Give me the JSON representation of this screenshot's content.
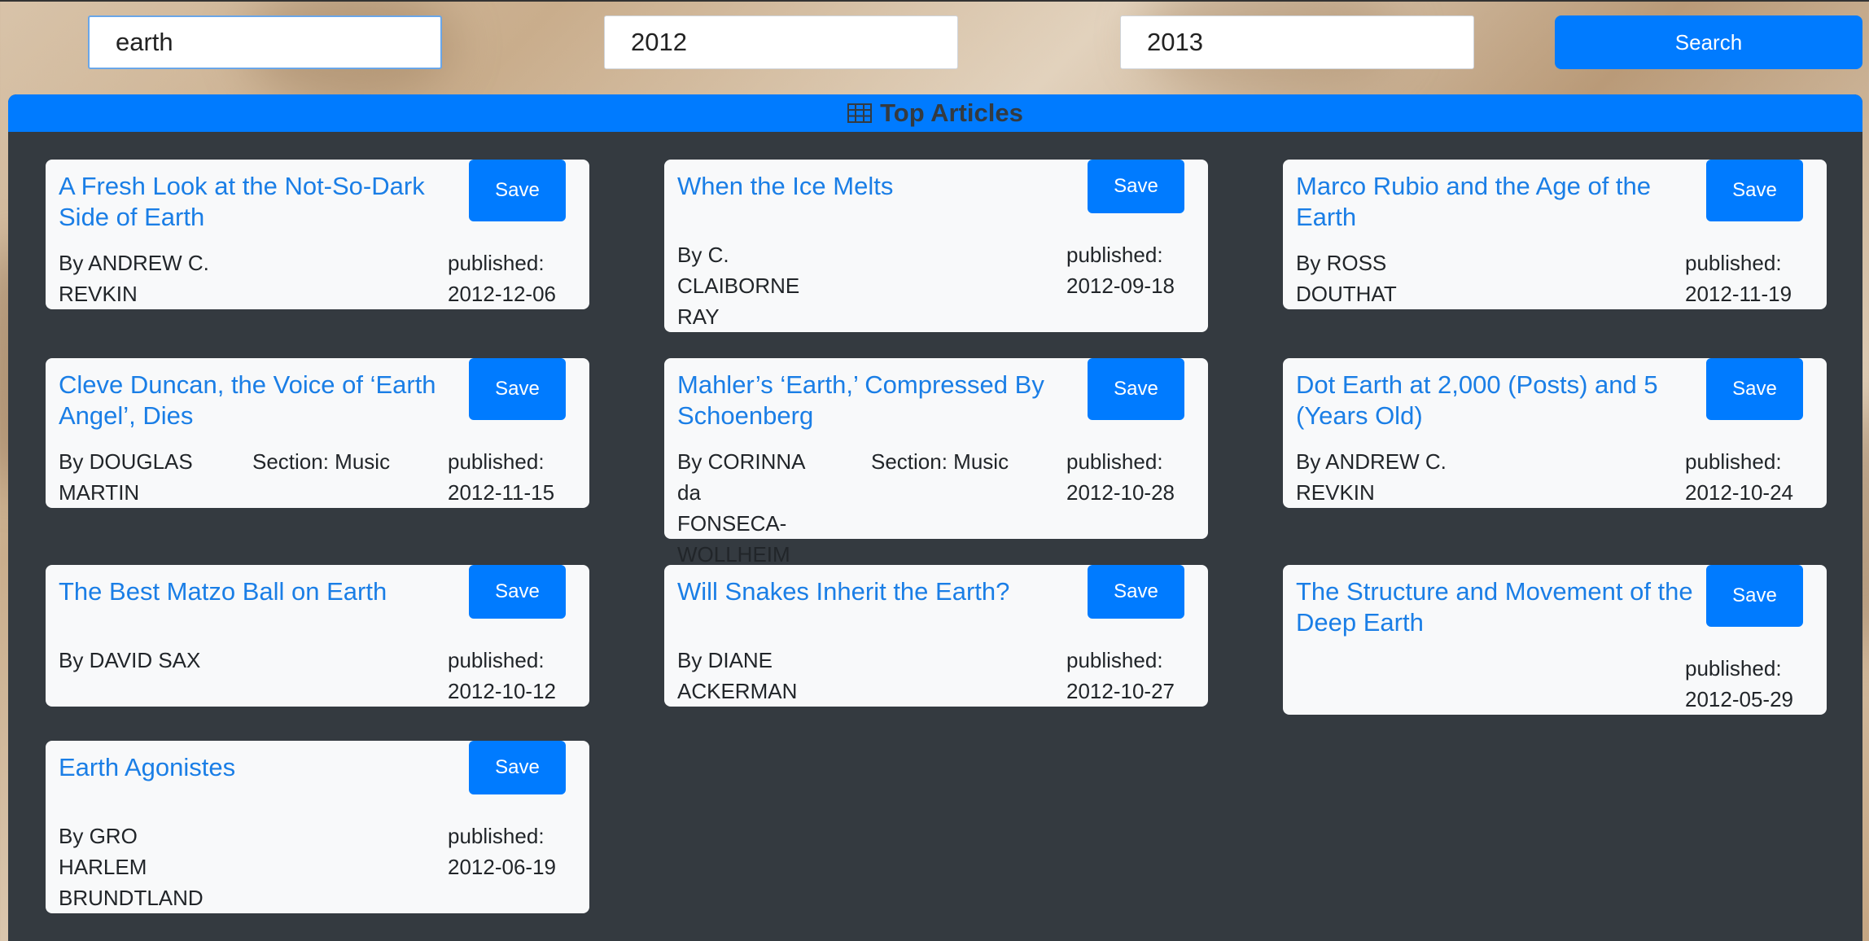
{
  "search": {
    "query": "earth",
    "start_year": "2012",
    "end_year": "2013",
    "button_label": "Search"
  },
  "panel": {
    "title": "Top Articles",
    "icon": "table-icon"
  },
  "labels": {
    "save": "Save",
    "published": "published:"
  },
  "articles": [
    {
      "title": "A Fresh Look at the Not-So-Dark Side of Earth",
      "byline": "By ANDREW C. REVKIN",
      "section": "",
      "date": "2012-12-06"
    },
    {
      "title": "When the Ice Melts",
      "byline": "By C. CLAIBORNE RAY",
      "section": "",
      "date": "2012-09-18"
    },
    {
      "title": "Marco Rubio and the Age of the Earth",
      "byline": "By ROSS DOUTHAT",
      "section": "",
      "date": "2012-11-19"
    },
    {
      "title": "Cleve Duncan, the Voice of ‘Earth Angel’, Dies",
      "byline": "By DOUGLAS MARTIN",
      "section": "Section: Music",
      "date": "2012-11-15"
    },
    {
      "title": "Mahler’s ‘Earth,’ Compressed By Schoenberg",
      "byline": "By CORINNA da FONSECA-WOLLHEIM",
      "section": "Section: Music",
      "date": "2012-10-28"
    },
    {
      "title": "Dot Earth at 2,000 (Posts) and 5 (Years Old)",
      "byline": "By ANDREW C. REVKIN",
      "section": "",
      "date": "2012-10-24"
    },
    {
      "title": "The Best Matzo Ball on Earth",
      "byline": "By DAVID SAX",
      "section": "",
      "date": "2012-10-12"
    },
    {
      "title": "Will Snakes Inherit the Earth?",
      "byline": "By DIANE ACKERMAN",
      "section": "",
      "date": "2012-10-27"
    },
    {
      "title": "The Structure and Movement of the Deep Earth",
      "byline": "",
      "section": "",
      "date": "2012-05-29"
    },
    {
      "title": "Earth Agonistes",
      "byline": "By GRO HARLEM BRUNDTLAND",
      "section": "",
      "date": "2012-06-19"
    }
  ]
}
